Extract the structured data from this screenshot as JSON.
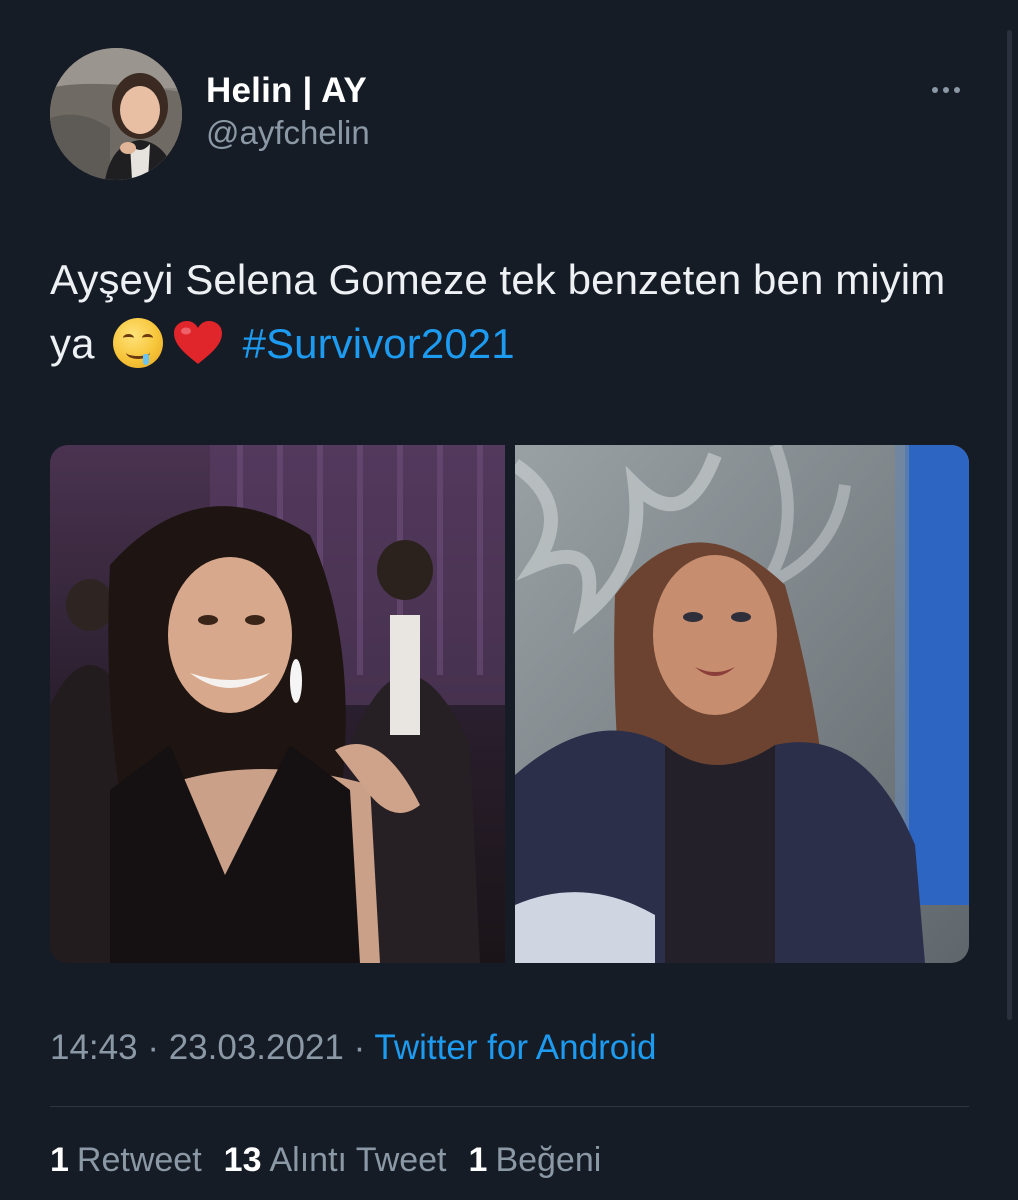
{
  "tweet": {
    "author": {
      "display_name": "Helin | AY",
      "handle": "@ayfchelin",
      "avatar_icon": "profile-photo"
    },
    "more_icon": "more-horizontal-icon",
    "text_before_emoji": "Ayşeyi Selena Gomeze tek benzeten ben miyim ya",
    "emojis": [
      "drooling-face-emoji",
      "red-heart-emoji"
    ],
    "hashtag": "#Survivor2021",
    "media": [
      {
        "name": "photo-1"
      },
      {
        "name": "photo-2"
      }
    ],
    "time": "14:43",
    "separator": "·",
    "date": "23.03.2021",
    "source": "Twitter for Android",
    "stats": {
      "retweets_count": "1",
      "retweets_label": "Retweet",
      "quotes_count": "13",
      "quotes_label": "Alıntı Tweet",
      "likes_count": "1",
      "likes_label": "Beğeni"
    }
  },
  "colors": {
    "background": "#161c26",
    "link": "#1d9bf0",
    "secondary_text": "#8b98a5",
    "primary_text": "#ffffff"
  }
}
